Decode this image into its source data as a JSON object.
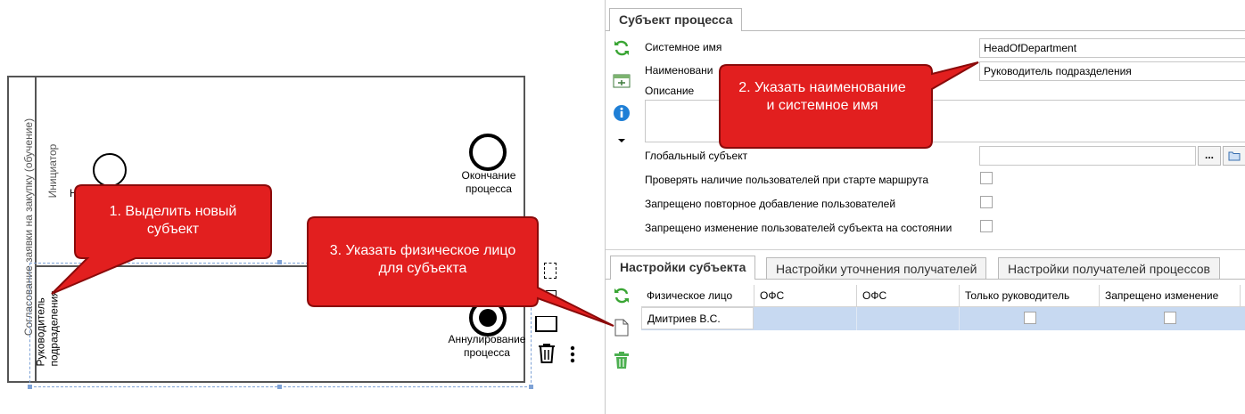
{
  "diagram": {
    "pool_label": "Согласование заявки на закупку (обучение)",
    "lane1_label": "Инициатор",
    "lane2_label": "Руководитель подразделения",
    "start_label_fragment": "Н",
    "end_label": "Окончание процесса",
    "cancel_label": "Аннулирование процесса"
  },
  "callouts": {
    "c1": "1. Выделить новый субъект",
    "c2": "2. Указать наименование и системное имя",
    "c3": "3. Указать физическое лицо для субъекта"
  },
  "panel": {
    "title_tab": "Субъект процесса",
    "system_name_label": "Системное имя",
    "system_name_value": "HeadOfDepartment",
    "name_label": "Наименовани",
    "name_value": "Руководитель подразделения",
    "description_label": "Описание",
    "global_subject_label": "Глобальный субъект",
    "global_subject_button": "...",
    "check_users_label": "Проверять наличие пользователей при старте маршрута",
    "no_repeat_add_label": "Запрещено повторное добавление пользователей",
    "no_change_label": "Запрещено изменение пользователей субъекта на состоянии",
    "tabs": [
      "Настройки субъекта",
      "Настройки уточнения получателей",
      "Настройки получателей процессов"
    ],
    "grid": {
      "columns": [
        "Физическое лицо",
        "ОФС",
        "ОФС",
        "Только руководитель",
        "Запрещено изменение"
      ],
      "rows": [
        {
          "person": "Дмитриев  В.С.",
          "ofs1": "",
          "ofs2": "",
          "only_head": false,
          "no_change": false
        }
      ]
    }
  },
  "colors": {
    "callout_red": "#e21f1f",
    "callout_border": "#8a0a0a",
    "refresh_green": "#3aa534",
    "info_blue": "#1f7fd6",
    "trash_green": "#4caf50",
    "row_selected": "#c7d9f1"
  }
}
